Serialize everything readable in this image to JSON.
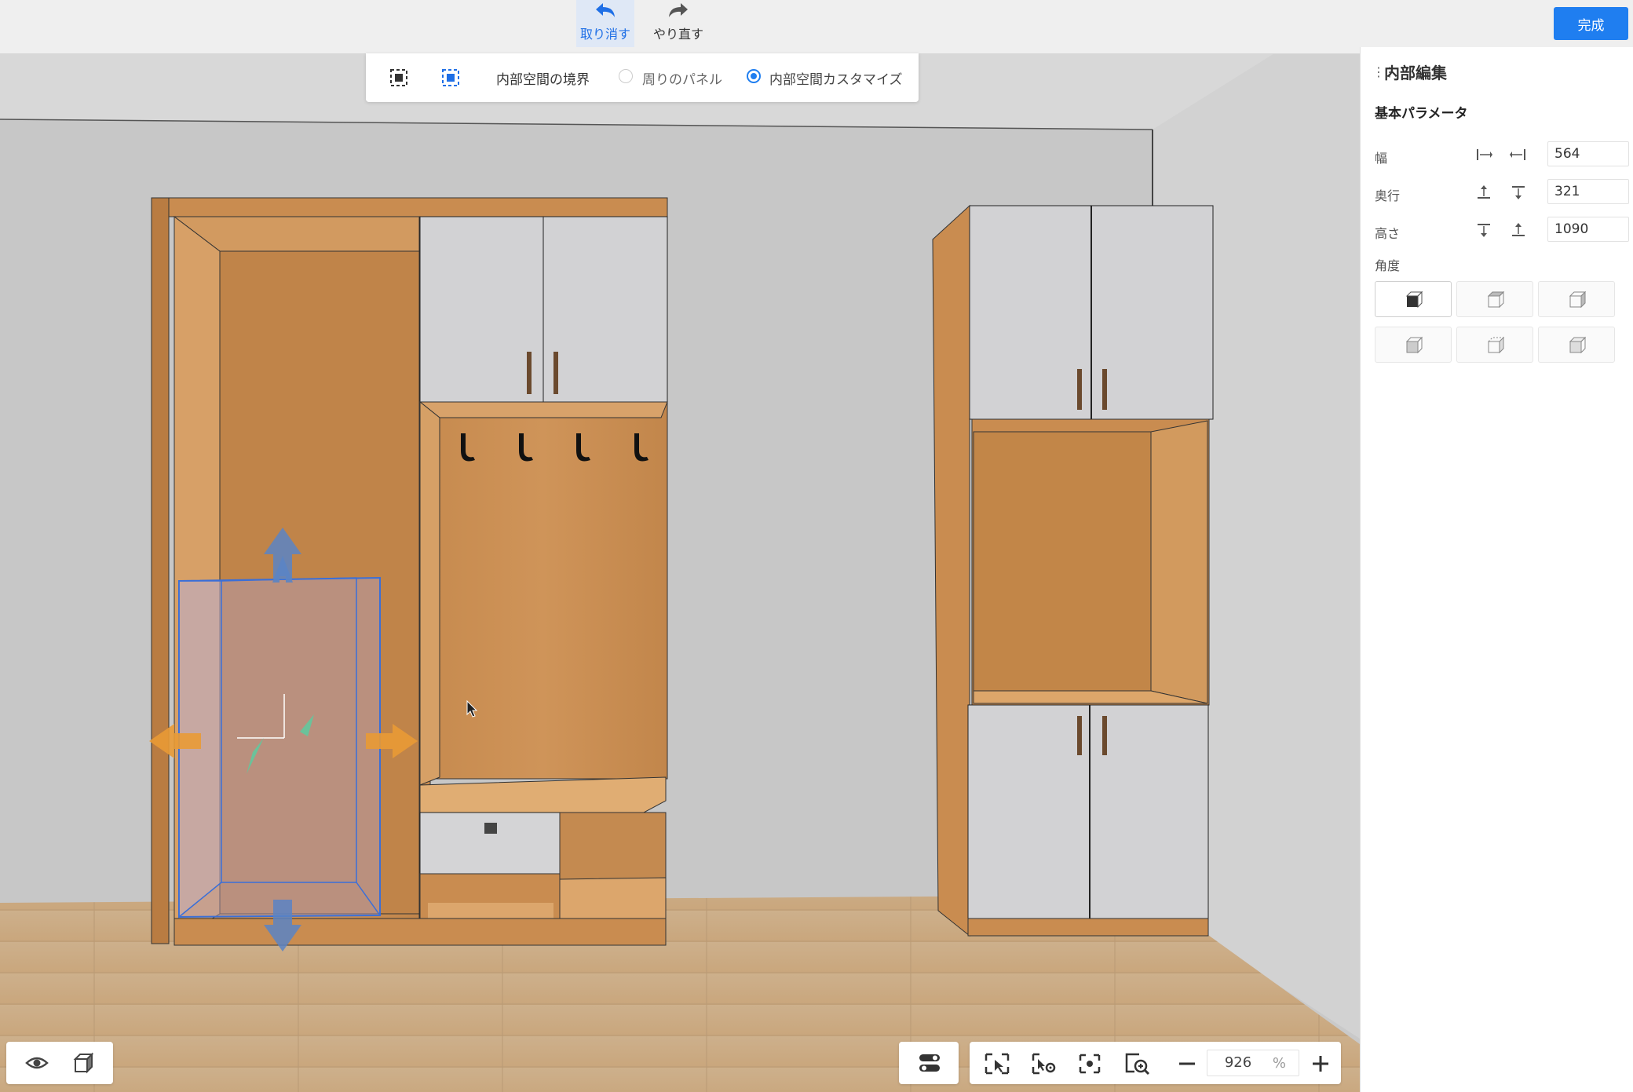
{
  "toolbar": {
    "undo_label": "取り消す",
    "redo_label": "やり直す",
    "done_label": "完成"
  },
  "mode_bar": {
    "boundary_label": "内部空間の境界",
    "option_panels": "周りのパネル",
    "option_custom": "内部空間カスタマイズ",
    "selected": "内部空間カスタマイズ"
  },
  "panel": {
    "title": "内部編集",
    "section": "基本パラメータ",
    "params": [
      {
        "label": "幅",
        "value": "564"
      },
      {
        "label": "奥行",
        "value": "321"
      },
      {
        "label": "高さ",
        "value": "1090"
      }
    ],
    "angle_label": "角度",
    "angle_selected_index": 0
  },
  "zoom": {
    "value": "926",
    "unit": "%"
  },
  "icons": [
    "undo-icon",
    "redo-icon",
    "select-boundary-icon",
    "select-inner-icon",
    "eye-icon",
    "cube-view-icon",
    "toggle-settings-icon",
    "frame-select-icon",
    "frame-settings-icon",
    "focus-icon",
    "zoom-region-icon",
    "minus-icon",
    "plus-icon"
  ],
  "colors": {
    "accent": "#1f7ef0",
    "wood": "#c98c50",
    "door": "#d4d4d6",
    "wall": "#c9c9c9",
    "floor": "#cfb089",
    "selection_box": "#3a6fd8",
    "arrow_orange": "#e99a35",
    "arrow_blue": "#5b84c4"
  }
}
